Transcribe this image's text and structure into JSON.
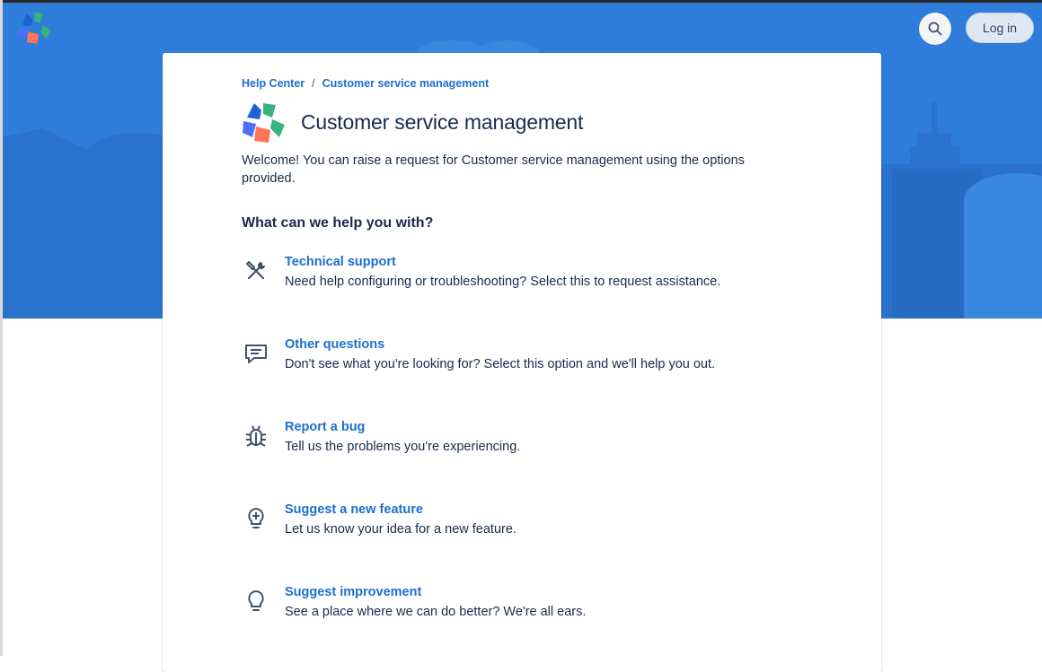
{
  "header": {
    "search_icon": "search-icon",
    "login_label": "Log in",
    "brand_colors": {
      "banner": "#2f7ddb",
      "link": "#1d6ecf",
      "text": "#172b4d"
    }
  },
  "breadcrumb": {
    "items": [
      "Help Center",
      "Customer service management"
    ],
    "separator": "/"
  },
  "portal": {
    "title": "Customer service management",
    "welcome": "Welcome! You can raise a request for Customer service management using the options provided.",
    "help_heading": "What can we help you with?"
  },
  "request_types": [
    {
      "name": "Technical support",
      "description": "Need help configuring or troubleshooting? Select this to request assistance.",
      "icon": "tools-icon"
    },
    {
      "name": "Other questions",
      "description": "Don't see what you're looking for? Select this option and we'll help you out.",
      "icon": "chat-icon"
    },
    {
      "name": "Report a bug",
      "description": "Tell us the problems you're experiencing.",
      "icon": "bug-icon"
    },
    {
      "name": "Suggest a new feature",
      "description": "Let us know your idea for a new feature.",
      "icon": "lightbulb-plus-icon"
    },
    {
      "name": "Suggest improvement",
      "description": "See a place where we can do better? We're all ears.",
      "icon": "lightbulb-icon"
    }
  ]
}
